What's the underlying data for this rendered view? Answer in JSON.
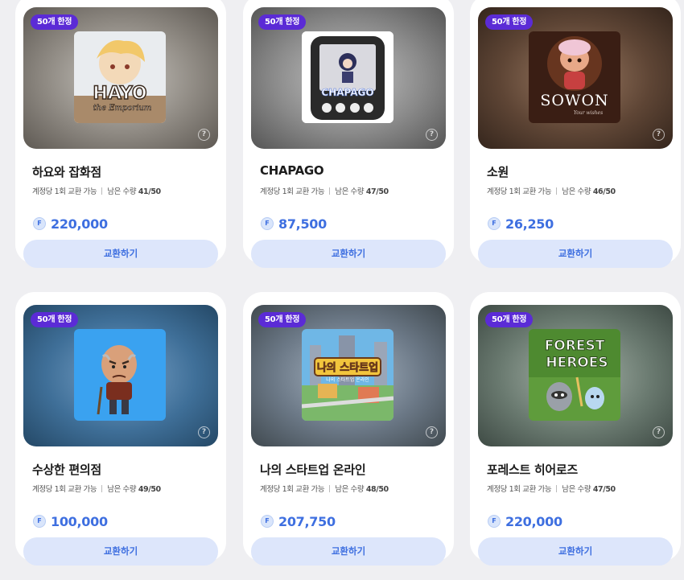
{
  "currency_symbol": "F",
  "help_symbol": "?",
  "colors": {
    "accent": "#3e6fe0",
    "badge": "#5b2bd6",
    "button_bg": "#dde6fb"
  },
  "items": [
    {
      "badge": "50개 한정",
      "title": "하요와 잡화점",
      "limit": "계정당 1회 교환 가능",
      "remaining_label": "남은 수량",
      "remaining": "41/50",
      "price": "220,000",
      "button": "교환하기",
      "image_text": "HAYO",
      "image_subtext": "the Emporium"
    },
    {
      "badge": "50개 한정",
      "title": "CHAPAGO",
      "limit": "계정당 1회 교환 가능",
      "remaining_label": "남은 수량",
      "remaining": "47/50",
      "price": "87,500",
      "button": "교환하기",
      "image_text": "CHAPAGO"
    },
    {
      "badge": "50개 한정",
      "title": "소원",
      "limit": "계정당 1회 교환 가능",
      "remaining_label": "남은 수량",
      "remaining": "46/50",
      "price": "26,250",
      "button": "교환하기",
      "image_text": "SOWON",
      "image_subtext": "Your wishes"
    },
    {
      "badge": "50개 한정",
      "title": "수상한 편의점",
      "limit": "계정당 1회 교환 가능",
      "remaining_label": "남은 수량",
      "remaining": "49/50",
      "price": "100,000",
      "button": "교환하기"
    },
    {
      "badge": "50개 한정",
      "title": "나의 스타트업 온라인",
      "limit": "계정당 1회 교환 가능",
      "remaining_label": "남은 수량",
      "remaining": "48/50",
      "price": "207,750",
      "button": "교환하기",
      "image_text": "나의 스타트업",
      "image_subtext": "나의 스타트업 온라인"
    },
    {
      "badge": "50개 한정",
      "title": "포레스트 히어로즈",
      "limit": "계정당 1회 교환 가능",
      "remaining_label": "남은 수량",
      "remaining": "47/50",
      "price": "220,000",
      "button": "교환하기",
      "image_text": "FOREST",
      "image_text2": "HEROES"
    }
  ]
}
